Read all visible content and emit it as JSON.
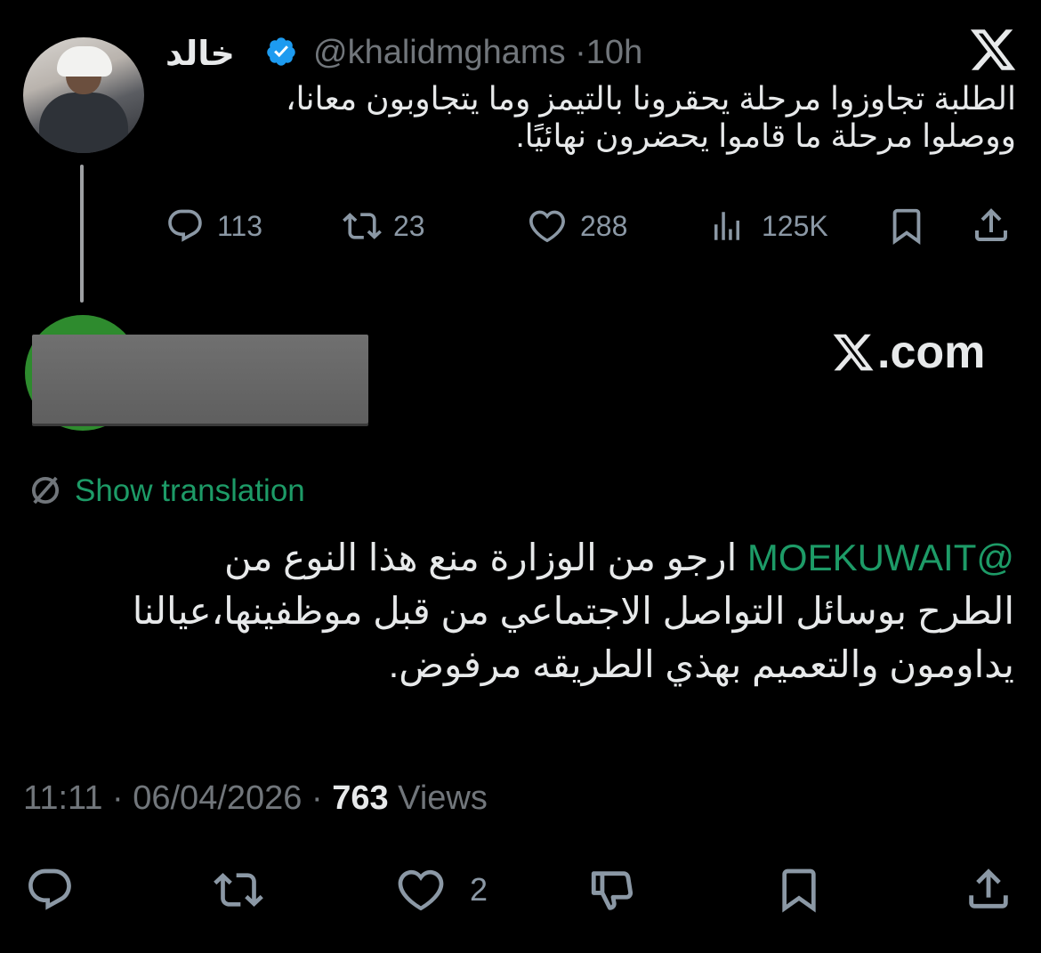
{
  "original_tweet": {
    "display_name": "خالد",
    "handle": "@khalidmghams",
    "separator": "·",
    "time_ago": "10h",
    "text_line1": "الطلبة تجاوزوا مرحلة يحقرونا بالتيمز وما يتجاوبون معانا،",
    "text_line2": "ووصلوا مرحلة ما قاموا يحضرون نهائيًا.",
    "replies": "113",
    "reposts": "23",
    "likes": "288",
    "views": "125K"
  },
  "reply_tweet": {
    "site_label": ".com",
    "translation_label": "Show translation",
    "mention": "@MOEKUWAIT",
    "text_after_mention": " ارجو من الوزارة منع هذا النوع من",
    "text_line2": "الطرح بوسائل التواصل الاجتماعي من قبل موظفينها،عيالنا",
    "text_line3": "يداومون والتعميم بهذي الطريقه مرفوض.",
    "time": "11:11",
    "date": "06/04/2026",
    "views_count": "763",
    "views_label": "Views",
    "separator": "·",
    "likes": "2"
  },
  "colors": {
    "background": "#000000",
    "text": "#e7e9ea",
    "muted": "#71767b",
    "accent_green": "#1d9b67",
    "verified_blue": "#1d9bf0"
  },
  "icons": [
    "reply-icon",
    "repost-icon",
    "like-icon",
    "views-icon",
    "bookmark-icon",
    "share-icon",
    "dislike-icon",
    "x-logo-icon",
    "verified-icon",
    "translate-icon"
  ]
}
